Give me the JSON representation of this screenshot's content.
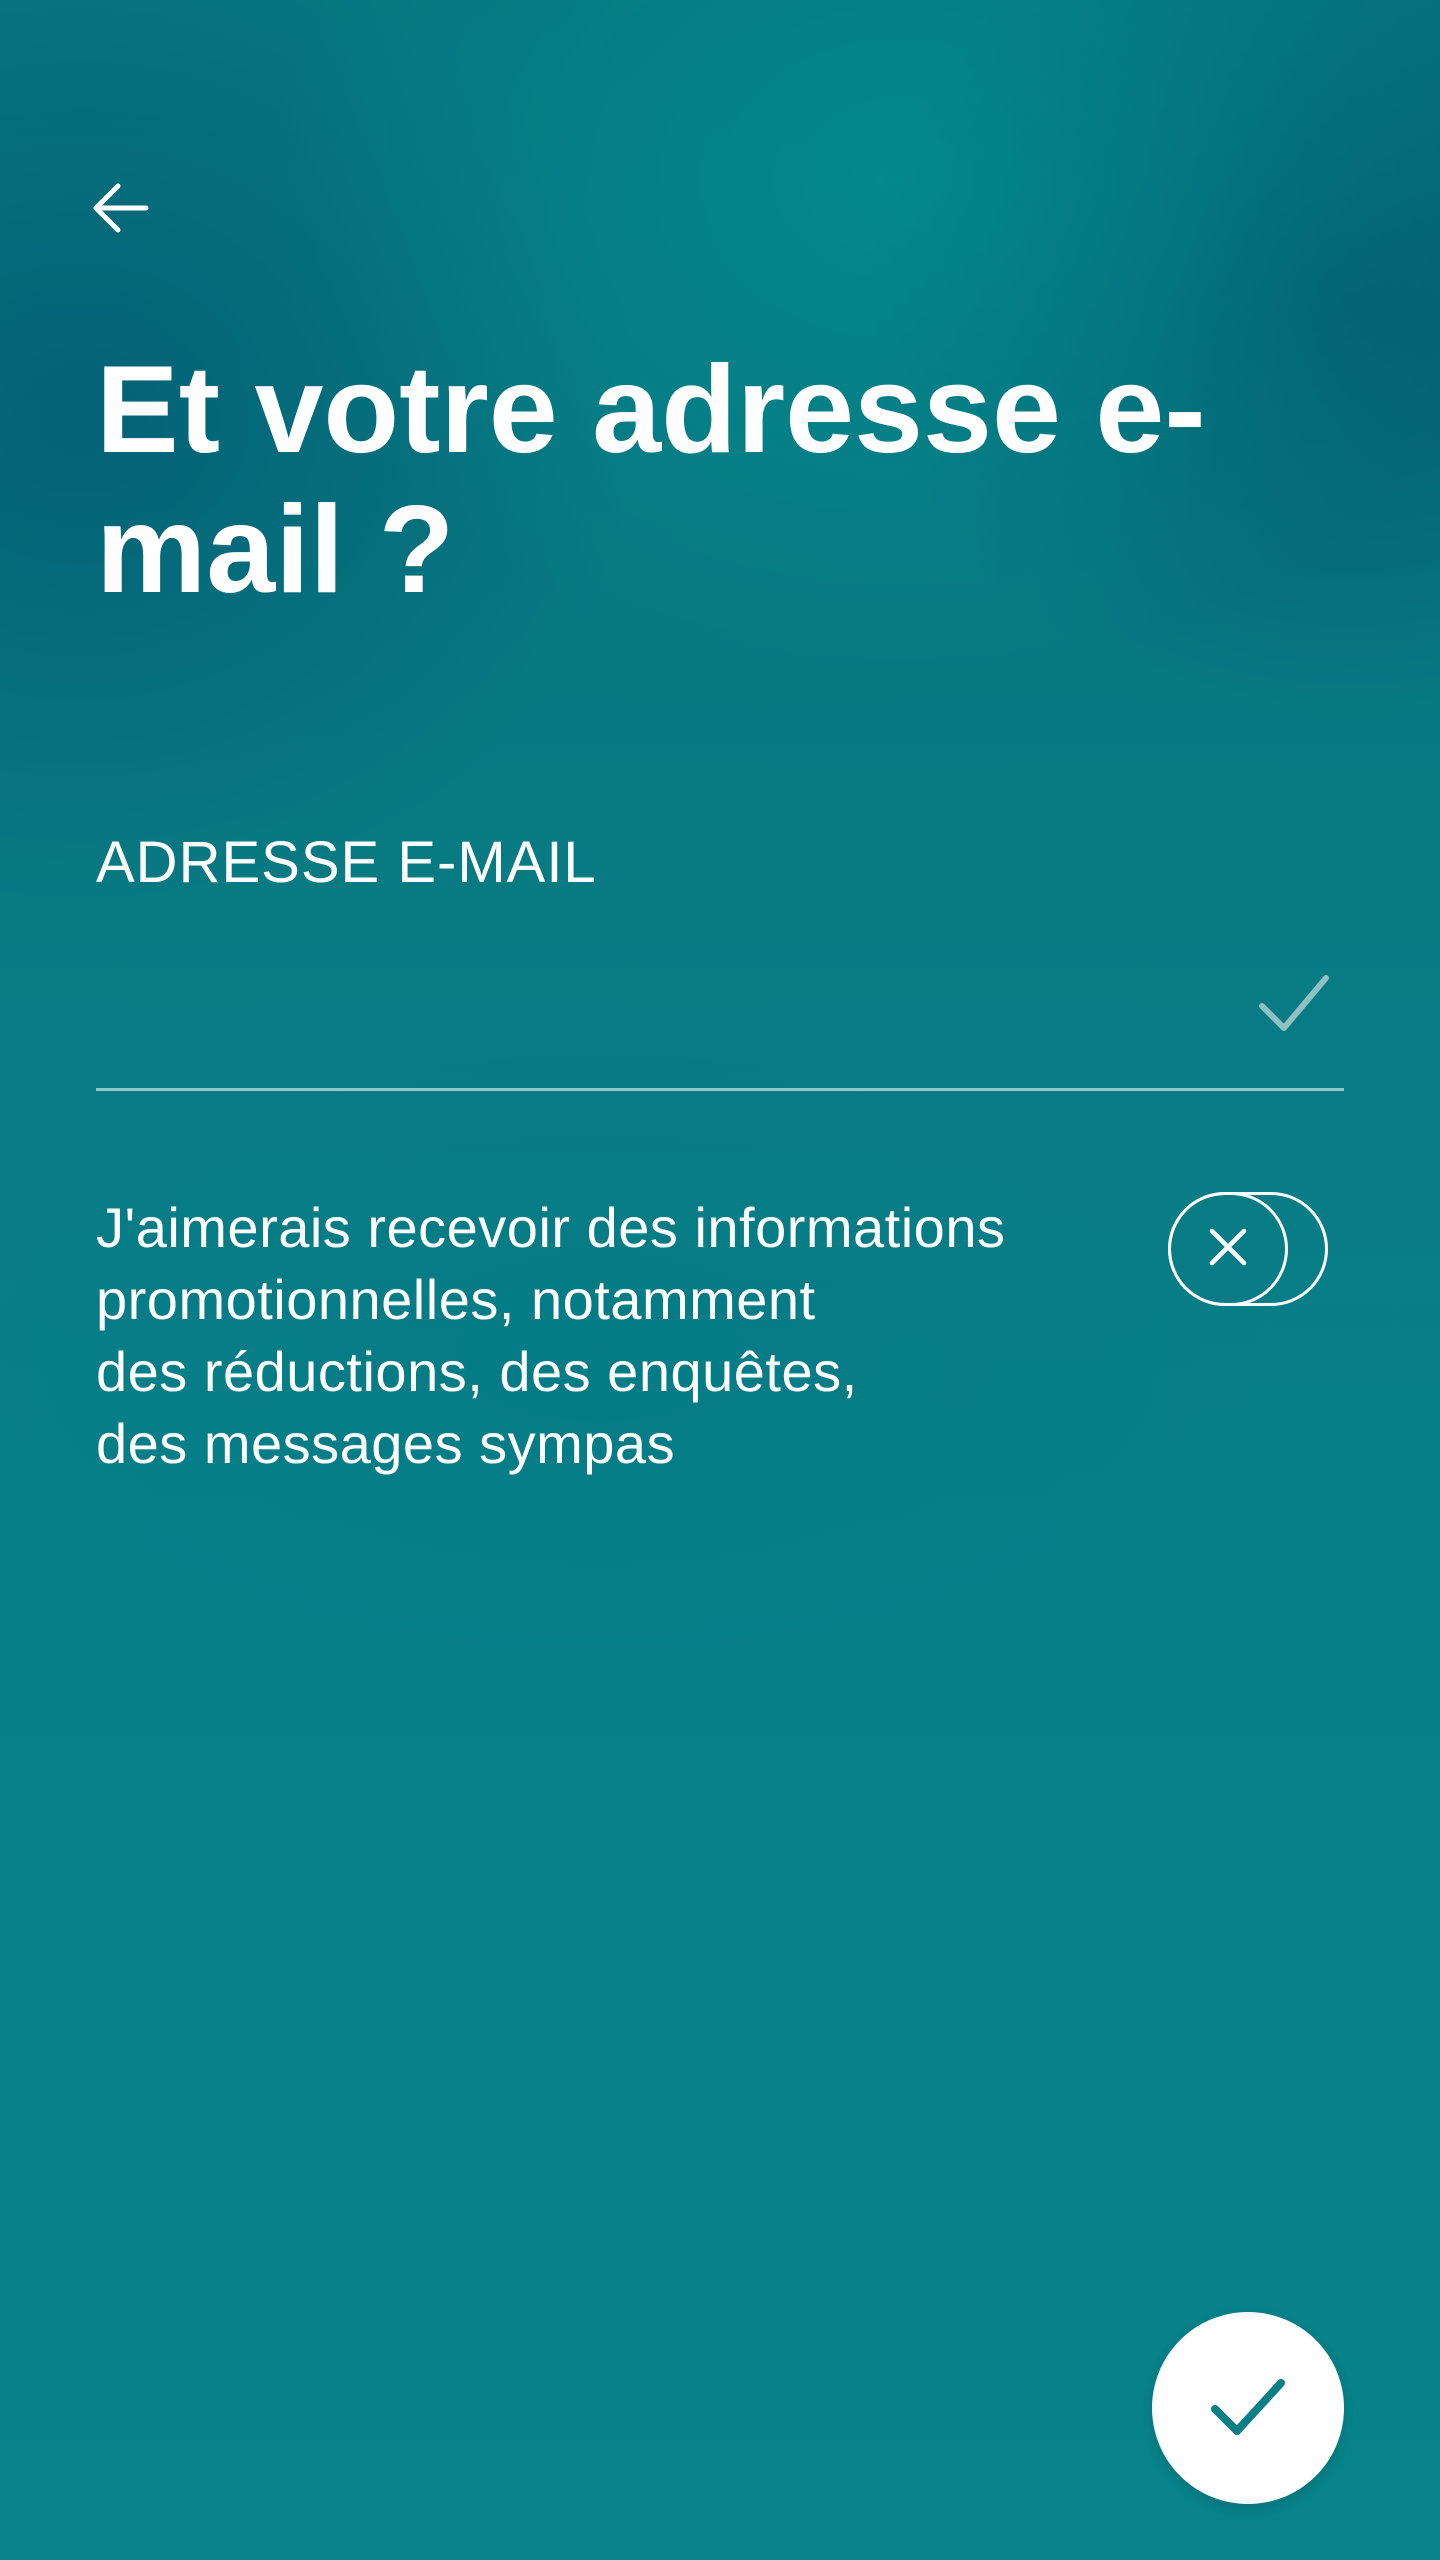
{
  "header": {
    "back_icon": "arrow-left-icon"
  },
  "main": {
    "title": "Et votre adresse e-\nmail ?",
    "email_field": {
      "label": "ADRESSE E-MAIL",
      "value": "",
      "placeholder": "",
      "status_icon": "check-icon"
    },
    "promo_optin": {
      "text": "J'aimerais recevoir des informations\npromotionnelles, notamment\ndes réductions, des enquêtes,\ndes messages sympas",
      "toggle_state": "off",
      "toggle_icon": "close-icon"
    }
  },
  "footer": {
    "submit_icon": "check-icon"
  },
  "colors": {
    "background": "#087a82",
    "accent": "#0a7f86",
    "text": "#ffffff",
    "field_check": "#8fc0c3"
  }
}
